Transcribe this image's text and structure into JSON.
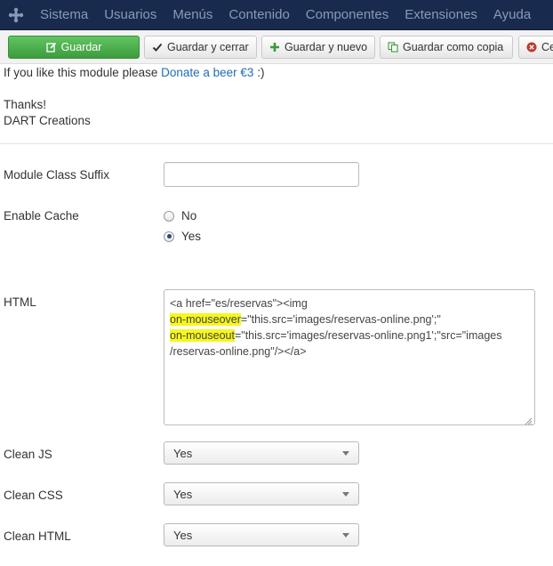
{
  "navbar": {
    "items": [
      "Sistema",
      "Usuarios",
      "Menús",
      "Contenido",
      "Componentes",
      "Extensiones",
      "Ayuda"
    ]
  },
  "toolbar": {
    "save": "Guardar",
    "save_close": "Guardar y cerrar",
    "save_new": "Guardar y nuevo",
    "save_copy": "Guardar como copia",
    "close_partial": "Ce"
  },
  "intro": {
    "donate_prefix": "If you like this module please ",
    "donate_link": "Donate a beer €3",
    "donate_suffix": " :)",
    "thanks": "Thanks!",
    "signature": "DART Creations"
  },
  "form": {
    "module_class_suffix": {
      "label": "Module Class Suffix",
      "value": ""
    },
    "enable_cache": {
      "label": "Enable Cache",
      "options": [
        "No",
        "Yes"
      ],
      "selected": "Yes"
    },
    "html": {
      "label": "HTML",
      "line1": "<a href=\"es/reservas\"><img",
      "attr_over": "on-mouseover",
      "line2_rest": "=\"this.src='images/reservas-online.png';\"",
      "attr_out": "on-mouseout",
      "line3_rest": "=\"this.src='images/reservas-online.png1';\"src=\"images",
      "line4": "/reservas-online.png\"/></a>"
    },
    "clean_js": {
      "label": "Clean JS",
      "value": "Yes"
    },
    "clean_css": {
      "label": "Clean CSS",
      "value": "Yes"
    },
    "clean_html": {
      "label": "Clean HTML",
      "value": "Yes"
    }
  },
  "colors": {
    "navbar": "#182a4e",
    "save_button": "#4cae4c",
    "link": "#1f6cb5",
    "highlight": "#f7f71d"
  }
}
